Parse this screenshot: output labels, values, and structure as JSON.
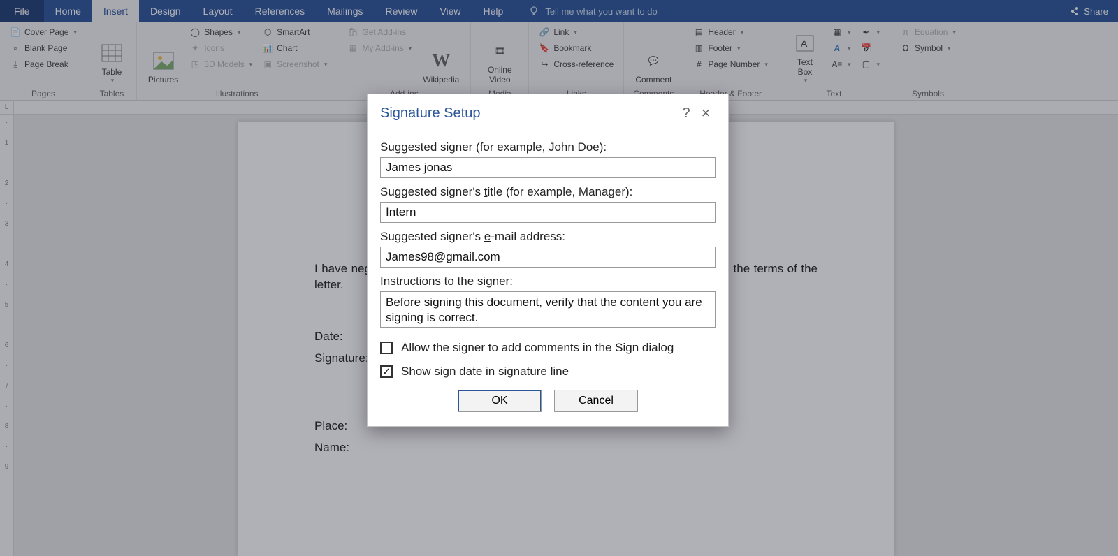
{
  "tabs": {
    "file": "File",
    "home": "Home",
    "insert": "Insert",
    "design": "Design",
    "layout": "Layout",
    "references": "References",
    "mailings": "Mailings",
    "review": "Review",
    "view": "View",
    "help": "Help"
  },
  "tellme": "Tell me what you want to do",
  "share": "Share",
  "ribbon": {
    "pages": {
      "cover": "Cover Page",
      "blank": "Blank Page",
      "break": "Page Break",
      "group": "Pages"
    },
    "tables": {
      "table": "Table",
      "group": "Tables"
    },
    "illus": {
      "pictures": "Pictures",
      "shapes": "Shapes",
      "icons": "Icons",
      "models": "3D Models",
      "smartart": "SmartArt",
      "chart": "Chart",
      "screenshot": "Screenshot",
      "group": "Illustrations"
    },
    "addins": {
      "get": "Get Add-ins",
      "my": "My Add-ins",
      "wikipedia": "Wikipedia",
      "group": "Add-ins"
    },
    "media": {
      "video": "Online Video",
      "group": "Media"
    },
    "links": {
      "link": "Link",
      "bookmark": "Bookmark",
      "xref": "Cross-reference",
      "group": "Links"
    },
    "comments": {
      "comment": "Comment",
      "group": "Comments"
    },
    "hf": {
      "header": "Header",
      "footer": "Footer",
      "pagenum": "Page Number",
      "group": "Header & Footer"
    },
    "text": {
      "textbox": "Text Box",
      "group": "Text"
    },
    "symbols": {
      "equation": "Equation",
      "symbol": "Symbol",
      "group": "Symbols"
    }
  },
  "document": {
    "para": "I have negotiated and agreed to every detail of this Internship letter as well as the terms of the letter.",
    "date": "Date:",
    "sig": "Signature:",
    "place": "Place:",
    "name": "Name:"
  },
  "dialog": {
    "title": "Signature Setup",
    "help": "?",
    "close": "×",
    "l_signer_a": "Suggested ",
    "l_signer_u": "s",
    "l_signer_b": "igner (for example, John Doe):",
    "v_signer": "James jonas",
    "l_title_a": "Suggested signer's ",
    "l_title_u": "t",
    "l_title_b": "itle (for example, Manager):",
    "v_title": "Intern",
    "l_email_a": "Suggested signer's ",
    "l_email_u": "e",
    "l_email_b": "-mail address:",
    "v_email": "James98@gmail.com",
    "l_instr_a": "",
    "l_instr_u": "I",
    "l_instr_b": "nstructions to the signer:",
    "v_instr": "Before signing this document, verify that the content you are signing is correct.",
    "chk1_a": "Allow the signer to add ",
    "chk1_u": "c",
    "chk1_b": "omments in the Sign dialog",
    "chk2_a": "Show sign ",
    "chk2_u": "d",
    "chk2_b": "ate in signature line",
    "chk1_checked": false,
    "chk2_checked": true,
    "ok": "OK",
    "cancel": "Cancel"
  },
  "ruler_corner": "L"
}
